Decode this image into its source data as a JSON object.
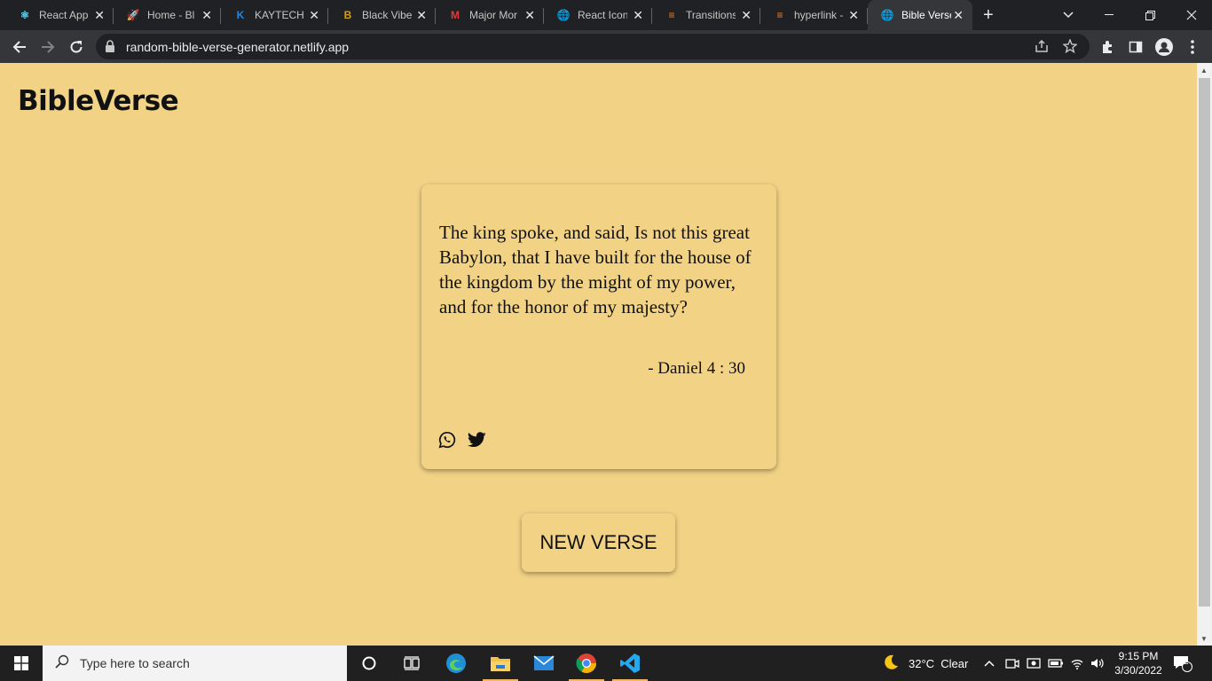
{
  "browser": {
    "tabs": [
      {
        "title": "React App",
        "icon": "react-icon",
        "color": "#61dafb",
        "glyph": "⚛",
        "active": false
      },
      {
        "title": "Home - Bl",
        "icon": "rocket-icon",
        "color": "#c084fc",
        "glyph": "🚀",
        "active": false
      },
      {
        "title": "KAYTECHIT",
        "icon": "kaytech-icon",
        "color": "#1e88e5",
        "glyph": "K",
        "active": false
      },
      {
        "title": "Black Vibe",
        "icon": "blackvibe-icon",
        "color": "#d4a017",
        "glyph": "B",
        "active": false
      },
      {
        "title": "Major Mor",
        "icon": "major-icon",
        "color": "#e53935",
        "glyph": "M",
        "active": false
      },
      {
        "title": "React Icon",
        "icon": "globe-icon",
        "color": "#9aa0a6",
        "glyph": "🌐",
        "active": false
      },
      {
        "title": "Transitions",
        "icon": "stackoverflow-icon",
        "color": "#f48024",
        "glyph": "≡",
        "active": false
      },
      {
        "title": "hyperlink -",
        "icon": "stackoverflow-icon",
        "color": "#f48024",
        "glyph": "≡",
        "active": false
      },
      {
        "title": "Bible Verse",
        "icon": "globe-icon",
        "color": "#9aa0a6",
        "glyph": "🌐",
        "active": true
      }
    ],
    "url": "random-bible-verse-generator.netlify.app"
  },
  "page": {
    "brand": "BibleVerse",
    "verse": {
      "text": "The king spoke, and said, Is not this great Babylon, that I have built for the house of the kingdom by the might of my power, and for the honor of my majesty?",
      "reference": "- Daniel 4 : 30"
    },
    "new_verse_label": "NEW VERSE"
  },
  "taskbar": {
    "search_placeholder": "Type here to search",
    "weather": "32°C  Clear",
    "time": "9:15 PM",
    "date": "3/30/2022",
    "notification_count": "2"
  },
  "colors": {
    "page_background": "#f2d386",
    "tab_strip": "#202124",
    "toolbar": "#35363a"
  }
}
